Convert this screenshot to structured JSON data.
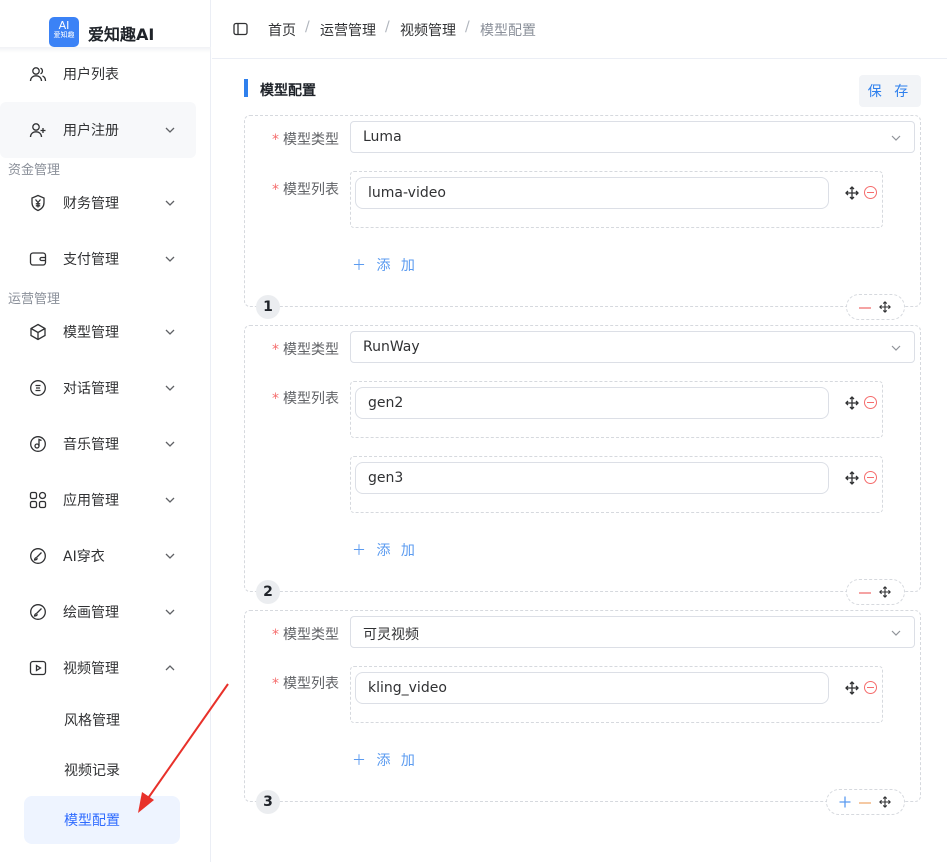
{
  "brand": {
    "logo_line1": "AI",
    "logo_line2": "爱知趣",
    "name": "爱知趣AI"
  },
  "sidebar": {
    "items": [
      {
        "label": "用户列表",
        "icon": "users-icon"
      },
      {
        "label": "用户注册",
        "icon": "user-add-icon"
      },
      {
        "label": "财务管理",
        "icon": "yen-shield-icon"
      },
      {
        "label": "支付管理",
        "icon": "wallet-icon"
      },
      {
        "label": "模型管理",
        "icon": "cube-icon"
      },
      {
        "label": "对话管理",
        "icon": "chat-icon"
      },
      {
        "label": "音乐管理",
        "icon": "music-disc-icon"
      },
      {
        "label": "应用管理",
        "icon": "apps-grid-icon"
      },
      {
        "label": "AI穿衣",
        "icon": "brush-icon"
      },
      {
        "label": "绘画管理",
        "icon": "brush-icon"
      },
      {
        "label": "视频管理",
        "icon": "video-icon"
      }
    ],
    "groups": {
      "finance": "资金管理",
      "operations": "运营管理"
    },
    "video_sub": [
      {
        "label": "风格管理"
      },
      {
        "label": "视频记录"
      },
      {
        "label": "模型配置",
        "active": true
      }
    ]
  },
  "breadcrumb": [
    "首页",
    "运营管理",
    "视频管理",
    "模型配置"
  ],
  "main": {
    "title": "模型配置",
    "save_label": "保 存",
    "field_type_label": "模型类型",
    "field_list_label": "模型列表",
    "add_label": "添 加",
    "groups": [
      {
        "index": "1",
        "type": "Luma",
        "models": [
          "luma-video"
        ]
      },
      {
        "index": "2",
        "type": "RunWay",
        "models": [
          "gen2",
          "gen3"
        ]
      },
      {
        "index": "3",
        "type": "可灵视频",
        "models": [
          "kling_video"
        ]
      }
    ]
  },
  "colors": {
    "accent": "#2f80ed",
    "danger": "#f56c6c",
    "active_bg": "#eef4ff"
  }
}
